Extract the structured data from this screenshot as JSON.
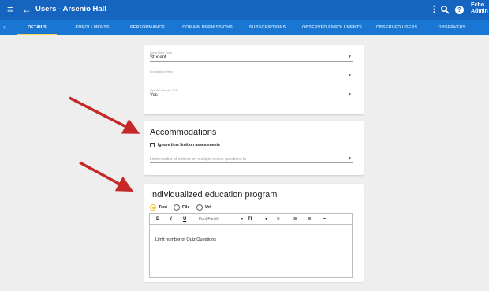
{
  "topbar": {
    "menu_icon": "menu-icon",
    "back_icon": "arrow-left-icon",
    "title": "Users - Arsenio Hall",
    "more_icon": "more-vert-icon",
    "search_icon": "search-icon",
    "help_icon": "help-icon",
    "help_glyph": "?",
    "user_line1": "Echo",
    "user_line2": "Admin"
  },
  "tabs": [
    {
      "label": "DETAILS"
    },
    {
      "label": "ENROLLMENTS"
    },
    {
      "label": "PERFORMANCE"
    },
    {
      "label": "DOMAIN PERMISSIONS"
    },
    {
      "label": "SUBSCRIPTIONS"
    },
    {
      "label": "OBSERVED ENROLLMENTS"
    },
    {
      "label": "OBSERVED USERS"
    },
    {
      "label": "OBSERVERS"
    }
  ],
  "details": {
    "user_type_label": "Echo User Type",
    "user_type_value": "Student",
    "grad_year_label": "Graduation Year",
    "grad_year_value": "---",
    "special_needs_label": "Special Needs / IEP",
    "special_needs_value": "Yes"
  },
  "accommodations": {
    "title": "Accommodations",
    "ignore_time_label": "Ignore time limit on assessments",
    "limit_options_placeholder": "Limit number of options on multiple-choice questions to"
  },
  "iep": {
    "title": "Individualized education program",
    "radio_text": "Text",
    "radio_file": "File",
    "radio_url": "Url",
    "toolbar": {
      "bold": "B",
      "italic": "I",
      "underline": "U",
      "font_family": "Font Family",
      "font_size": "TI",
      "color": "●",
      "align": "≡",
      "ul": "☰",
      "ol": "☰",
      "link": "⚭"
    },
    "body_text": "Limit number of Quiz Questions"
  },
  "colors": {
    "appbar": "#1565c0",
    "tabbar": "#1976d2",
    "tab_indicator": "#ffd54f",
    "radio_selected": "#fbc02d",
    "annotation_arrow": "#c62828"
  }
}
